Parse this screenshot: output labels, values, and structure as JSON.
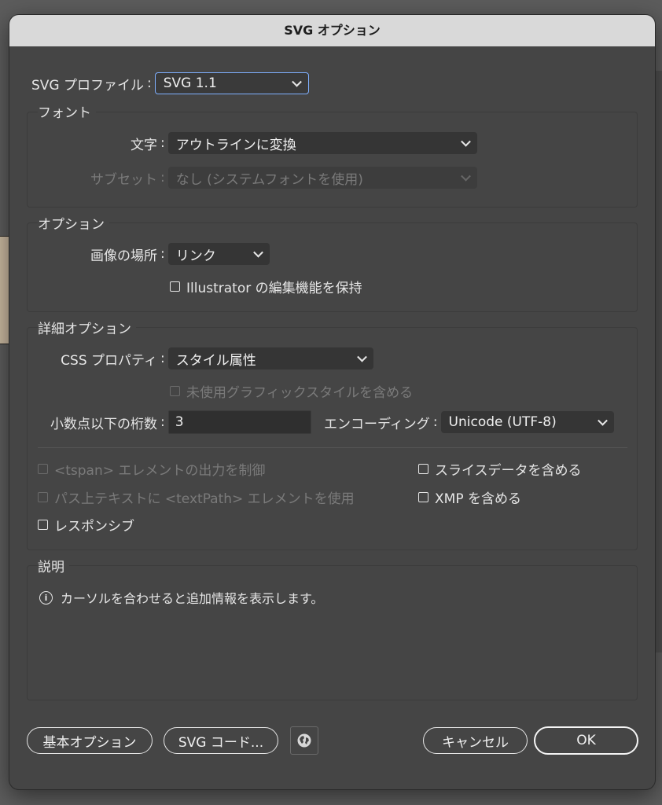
{
  "dialog": {
    "title": "SVG オプション"
  },
  "profile": {
    "label": "SVG プロファイル",
    "value": "SVG 1.1"
  },
  "fonts": {
    "title": "フォント",
    "type_label": "文字",
    "type_value": "アウトラインに変換",
    "subset_label": "サブセット",
    "subset_value": "なし (システムフォントを使用)"
  },
  "options": {
    "title": "オプション",
    "image_location_label": "画像の場所",
    "image_location_value": "リンク",
    "preserve_editing_label": "Illustrator の編集機能を保持",
    "preserve_editing_checked": false
  },
  "advanced": {
    "title": "詳細オプション",
    "css_label": "CSS プロパティ",
    "css_value": "スタイル属性",
    "unused_styles_label": "未使用グラフィックスタイルを含める",
    "decimal_label": "小数点以下の桁数",
    "decimal_value": "3",
    "encoding_label": "エンコーディング",
    "encoding_value": "Unicode (UTF-8)",
    "tspan_label": "<tspan> エレメントの出力を制御",
    "textpath_label": "パス上テキストに <textPath> エレメントを使用",
    "responsive_label": "レスポンシブ",
    "slice_label": "スライスデータを含める",
    "xmp_label": "XMP を含める"
  },
  "description": {
    "title": "説明",
    "text": "カーソルを合わせると追加情報を表示します。"
  },
  "buttons": {
    "less_options": "基本オプション",
    "svg_code": "SVG コード...",
    "cancel": "キャンセル",
    "ok": "OK"
  },
  "colors": {
    "background": "#454545",
    "titlebar": "#d9d9d9",
    "focus_ring": "#7fb0ff"
  }
}
